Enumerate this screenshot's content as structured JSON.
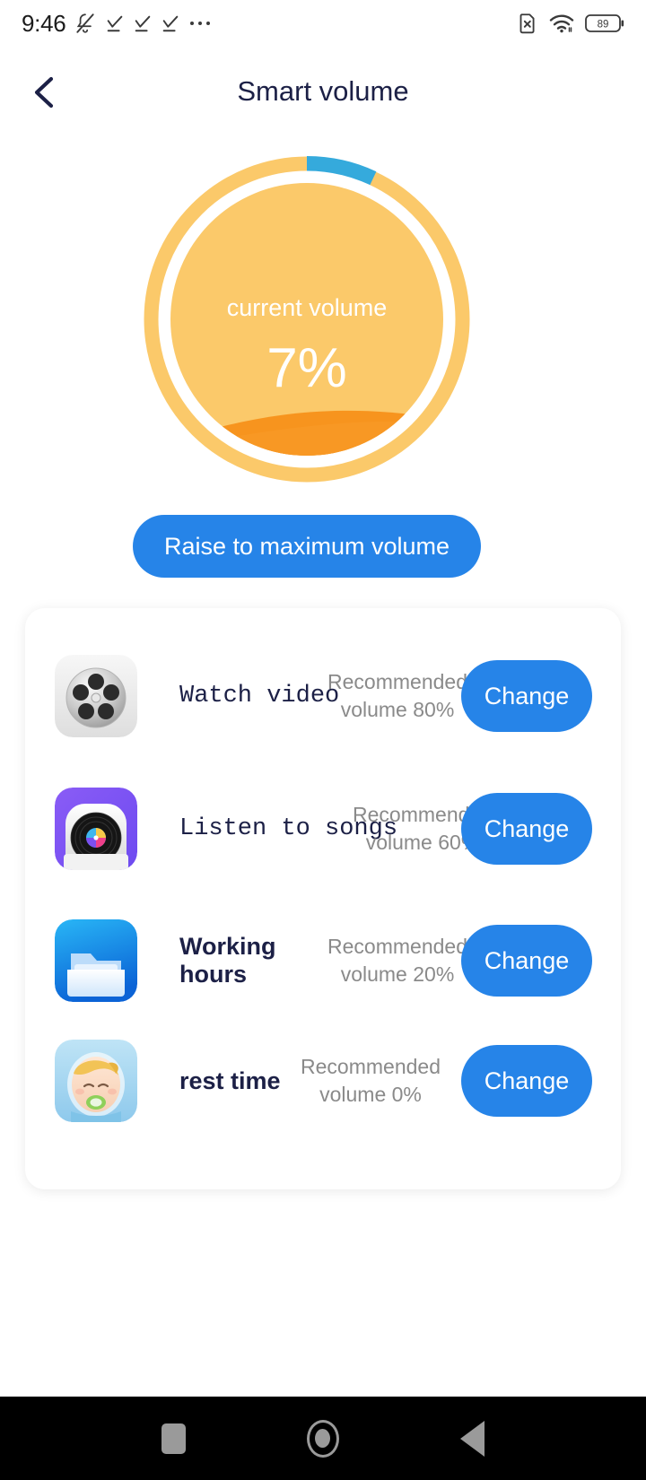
{
  "status_bar": {
    "time": "9:46",
    "left_icons": [
      "bell-muted-icon",
      "download-check-icon",
      "download-check-icon",
      "download-check-icon",
      "ellipsis-icon"
    ],
    "right_icons": [
      "sim-error-icon",
      "wifi-icon",
      "battery-icon"
    ],
    "battery_level": "89"
  },
  "header": {
    "title": "Smart volume",
    "back_icon": "chevron-left-icon"
  },
  "dial": {
    "label": "current volume",
    "value": "7%",
    "percent": 7,
    "ring_color": "#fbc96a",
    "arc_color": "#35aadc",
    "wave_color": "#f7941e",
    "gap_color": "#ffffff"
  },
  "primary_action": {
    "label": "Raise to maximum volume",
    "color": "#2684e8"
  },
  "scenes": {
    "change_label": "Change",
    "items": [
      {
        "name": "Watch video",
        "recommendation": "Recommended volume 80%",
        "recommended_percent": "80%",
        "icon": "film-reel-icon",
        "font": "mono"
      },
      {
        "name": "Listen to songs",
        "recommendation": "Recommended volume 60%",
        "recommended_percent": "60%",
        "icon": "vinyl-record-icon",
        "font": "mono"
      },
      {
        "name": "Working hours",
        "recommendation": "Recommended volume 20%",
        "recommended_percent": "20%",
        "icon": "folder-icon",
        "font": "sans"
      },
      {
        "name": "rest time",
        "recommendation": "Recommended volume 0%",
        "recommended_percent": "0%",
        "icon": "sleeping-baby-icon",
        "font": "sans"
      }
    ]
  },
  "nav_bar": {
    "recents": "recents-square-icon",
    "home": "home-circle-icon",
    "back": "back-triangle-icon"
  }
}
